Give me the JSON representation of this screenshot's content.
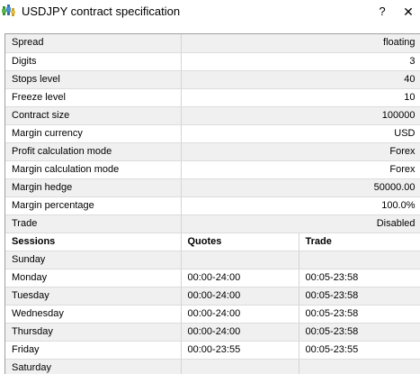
{
  "window": {
    "title": "USDJPY contract specification",
    "help_label": "?",
    "close_label": "✕",
    "icon": "market-watch-icon"
  },
  "specs": [
    {
      "name": "Spread",
      "value": "floating"
    },
    {
      "name": "Digits",
      "value": "3"
    },
    {
      "name": "Stops level",
      "value": "40"
    },
    {
      "name": "Freeze level",
      "value": "10"
    },
    {
      "name": "Contract size",
      "value": "100000"
    },
    {
      "name": "Margin currency",
      "value": "USD"
    },
    {
      "name": "Profit calculation mode",
      "value": "Forex"
    },
    {
      "name": "Margin calculation mode",
      "value": "Forex"
    },
    {
      "name": "Margin hedge",
      "value": "50000.00"
    },
    {
      "name": "Margin percentage",
      "value": "100.0%"
    },
    {
      "name": "Trade",
      "value": "Disabled"
    }
  ],
  "sessions": {
    "headers": {
      "day": "Sessions",
      "quotes": "Quotes",
      "trade": "Trade"
    },
    "rows": [
      {
        "day": "Sunday",
        "quotes": "",
        "trade": ""
      },
      {
        "day": "Monday",
        "quotes": "00:00-24:00",
        "trade": "00:05-23:58"
      },
      {
        "day": "Tuesday",
        "quotes": "00:00-24:00",
        "trade": "00:05-23:58"
      },
      {
        "day": "Wednesday",
        "quotes": "00:00-24:00",
        "trade": "00:05-23:58"
      },
      {
        "day": "Thursday",
        "quotes": "00:00-24:00",
        "trade": "00:05-23:58"
      },
      {
        "day": "Friday",
        "quotes": "00:00-23:55",
        "trade": "00:05-23:55"
      },
      {
        "day": "Saturday",
        "quotes": "",
        "trade": ""
      }
    ]
  }
}
